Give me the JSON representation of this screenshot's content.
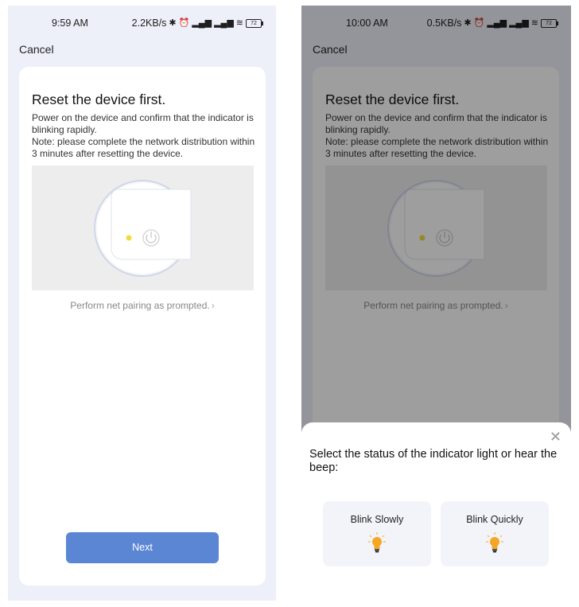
{
  "left_screen": {
    "status_bar": {
      "time": "9:59 AM",
      "net_speed": "2.2KB/s",
      "battery": "72"
    },
    "cancel_label": "Cancel",
    "title": "Reset the device first.",
    "description_line1": "Power on the device and confirm that the indicator is blinking rapidly.",
    "description_line2": "Note: please complete the network distribution within 3 minutes after resetting the device.",
    "prompt_link": "Perform net pairing as prompted.",
    "next_label": "Next"
  },
  "right_screen": {
    "status_bar": {
      "time": "10:00 AM",
      "net_speed": "0.5KB/s",
      "battery": "72"
    },
    "cancel_label": "Cancel",
    "title": "Reset the device first.",
    "description_line1": "Power on the device and confirm that the indicator is blinking rapidly.",
    "description_line2": "Note: please complete the network distribution within 3 minutes after resetting the device.",
    "prompt_link": "Perform net pairing as prompted.",
    "sheet": {
      "question": "Select the status of the indicator light or hear the beep:",
      "options": [
        {
          "label": "Blink Slowly",
          "icon": "lightbulb-icon"
        },
        {
          "label": "Blink Quickly",
          "icon": "lightbulb-icon"
        }
      ]
    }
  },
  "colors": {
    "primary_button": "#5b86d3",
    "indicator_yellow": "#f2dc3c",
    "bulb_orange": "#f5a623"
  }
}
